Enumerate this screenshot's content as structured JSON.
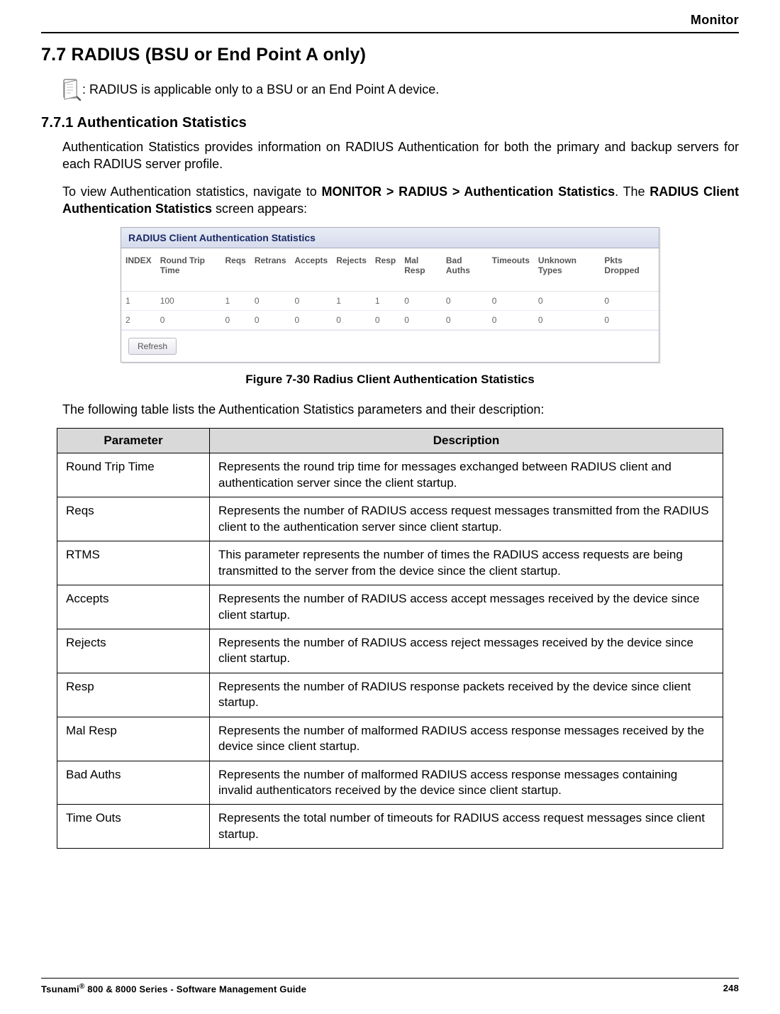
{
  "header": {
    "label": "Monitor"
  },
  "section": {
    "number": "7.7",
    "title": "RADIUS (BSU or End Point A only)",
    "note": ": RADIUS is applicable only to a BSU or an End Point A device."
  },
  "subsection": {
    "number": "7.7.1",
    "title": "Authentication Statistics",
    "p1": "Authentication Statistics provides information on RADIUS Authentication for both the primary and backup servers for each RADIUS server profile.",
    "p2a": "To view Authentication statistics, navigate to ",
    "p2b_bold": "MONITOR > RADIUS > Authentication Statistics",
    "p2c": ". The ",
    "p2d_bold": "RADIUS Client Authentication Statistics",
    "p2e": " screen appears:"
  },
  "screenshot": {
    "panel_title": "RADIUS Client Authentication Statistics",
    "headers": [
      "INDEX",
      "Round Trip Time",
      "Reqs",
      "Retrans",
      "Accepts",
      "Rejects",
      "Resp",
      "Mal Resp",
      "Bad Auths",
      "Timeouts",
      "Unknown Types",
      "Pkts Dropped"
    ],
    "rows": [
      [
        "1",
        "100",
        "1",
        "0",
        "0",
        "1",
        "1",
        "0",
        "0",
        "0",
        "0",
        "0"
      ],
      [
        "2",
        "0",
        "0",
        "0",
        "0",
        "0",
        "0",
        "0",
        "0",
        "0",
        "0",
        "0"
      ]
    ],
    "refresh": "Refresh"
  },
  "figure_caption": "Figure 7-30 Radius Client Authentication Statistics",
  "intro_table": "The following table lists the Authentication Statistics parameters and their description:",
  "params": {
    "col_param": "Parameter",
    "col_desc": "Description",
    "rows": [
      {
        "p": "Round Trip Time",
        "d": "Represents the round trip time for messages exchanged between RADIUS client and authentication server since the client startup."
      },
      {
        "p": "Reqs",
        "d": "Represents the number of RADIUS access request messages transmitted from the RADIUS client to the authentication server since client startup."
      },
      {
        "p": "RTMS",
        "d": "This parameter represents the number of times the RADIUS access requests are being transmitted to the server from the device since the client startup."
      },
      {
        "p": "Accepts",
        "d": "Represents the number of RADIUS access accept messages received by the device since client startup."
      },
      {
        "p": "Rejects",
        "d": "Represents the number of RADIUS access reject messages received by the device since client startup."
      },
      {
        "p": "Resp",
        "d": "Represents the number of RADIUS response packets received by the device since client startup."
      },
      {
        "p": "Mal Resp",
        "d": "Represents the number of malformed RADIUS access response messages received by the device since client startup."
      },
      {
        "p": "Bad Auths",
        "d": "Represents the number of malformed RADIUS access response messages containing invalid authenticators received by the device since client startup."
      },
      {
        "p": "Time Outs",
        "d": "Represents the total number of timeouts for RADIUS access request messages since client startup."
      }
    ]
  },
  "footer": {
    "left_a": "Tsunami",
    "left_b": " 800 & 8000 Series - Software Management Guide",
    "page": "248"
  }
}
